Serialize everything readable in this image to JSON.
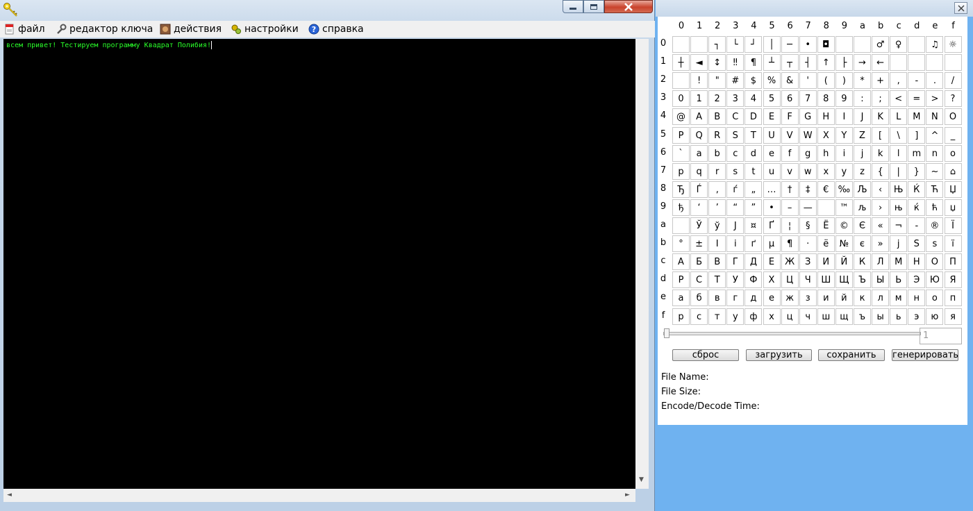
{
  "main_window": {
    "menu": [
      {
        "label": "файл",
        "icon": "file-icon"
      },
      {
        "label": "редактор ключа",
        "icon": "wrench-icon"
      },
      {
        "label": "действия",
        "icon": "actions-icon"
      },
      {
        "label": "настройки",
        "icon": "settings-icon"
      },
      {
        "label": "справка",
        "icon": "help-icon"
      }
    ],
    "editor_text": "всем привет! Тестируем программу Квадрат Полибия!"
  },
  "code_window": {
    "col_headers": [
      "0",
      "1",
      "2",
      "3",
      "4",
      "5",
      "6",
      "7",
      "8",
      "9",
      "a",
      "b",
      "c",
      "d",
      "e",
      "f"
    ],
    "row_headers": [
      "0",
      "1",
      "2",
      "3",
      "4",
      "5",
      "6",
      "7",
      "8",
      "9",
      "a",
      "b",
      "c",
      "d",
      "e",
      "f"
    ],
    "rows": [
      [
        "",
        "",
        "┐",
        "└",
        "┘",
        "│",
        "─",
        "•",
        "◘",
        "",
        "",
        "♂",
        "♀",
        "",
        "♫",
        "☼"
      ],
      [
        "┼",
        "◄",
        "↕",
        "‼",
        "¶",
        "┴",
        "┬",
        "┤",
        "↑",
        "├",
        "→",
        "←",
        "",
        "",
        "",
        ""
      ],
      [
        "",
        "!",
        "\"",
        "#",
        "$",
        "%",
        "&",
        "'",
        "(",
        ")",
        "*",
        "+",
        ",",
        "-",
        ".",
        "/"
      ],
      [
        "0",
        "1",
        "2",
        "3",
        "4",
        "5",
        "6",
        "7",
        "8",
        "9",
        ":",
        ";",
        "<",
        "=",
        ">",
        "?"
      ],
      [
        "@",
        "A",
        "B",
        "C",
        "D",
        "E",
        "F",
        "G",
        "H",
        "I",
        "J",
        "K",
        "L",
        "M",
        "N",
        "O"
      ],
      [
        "P",
        "Q",
        "R",
        "S",
        "T",
        "U",
        "V",
        "W",
        "X",
        "Y",
        "Z",
        "[",
        "\\",
        "]",
        "^",
        "_"
      ],
      [
        "`",
        "a",
        "b",
        "c",
        "d",
        "e",
        "f",
        "g",
        "h",
        "i",
        "j",
        "k",
        "l",
        "m",
        "n",
        "o"
      ],
      [
        "p",
        "q",
        "r",
        "s",
        "t",
        "u",
        "v",
        "w",
        "x",
        "y",
        "z",
        "{",
        "|",
        "}",
        "~",
        "⌂"
      ],
      [
        "Ђ",
        "Ѓ",
        "‚",
        "ѓ",
        "„",
        "…",
        "†",
        "‡",
        "€",
        "‰",
        "Љ",
        "‹",
        "Њ",
        "Ќ",
        "Ћ",
        "Џ"
      ],
      [
        "ђ",
        "‘",
        "’",
        "“",
        "”",
        "•",
        "–",
        "—",
        "",
        "™",
        "љ",
        "›",
        "њ",
        "ќ",
        "ћ",
        "џ"
      ],
      [
        "",
        "Ў",
        "ў",
        "Ј",
        "¤",
        "Ґ",
        "¦",
        "§",
        "Ё",
        "©",
        "Є",
        "«",
        "¬",
        "-",
        "®",
        "Ї"
      ],
      [
        "°",
        "±",
        "І",
        "і",
        "ґ",
        "µ",
        "¶",
        "·",
        "ё",
        "№",
        "є",
        "»",
        "ј",
        "Ѕ",
        "ѕ",
        "ї"
      ],
      [
        "А",
        "Б",
        "В",
        "Г",
        "Д",
        "Е",
        "Ж",
        "З",
        "И",
        "Й",
        "К",
        "Л",
        "М",
        "Н",
        "О",
        "П"
      ],
      [
        "Р",
        "С",
        "Т",
        "У",
        "Ф",
        "Х",
        "Ц",
        "Ч",
        "Ш",
        "Щ",
        "Ъ",
        "Ы",
        "Ь",
        "Э",
        "Ю",
        "Я"
      ],
      [
        "а",
        "б",
        "в",
        "г",
        "д",
        "е",
        "ж",
        "з",
        "и",
        "й",
        "к",
        "л",
        "м",
        "н",
        "о",
        "п"
      ],
      [
        "р",
        "с",
        "т",
        "у",
        "ф",
        "х",
        "ц",
        "ч",
        "ш",
        "щ",
        "ъ",
        "ы",
        "ь",
        "э",
        "ю",
        "я"
      ]
    ],
    "counter_value": "1",
    "buttons": {
      "reset": "сброс",
      "load": "загрузить",
      "save": "сохранить",
      "generate": "генерировать"
    },
    "info": {
      "file_name": "File Name:",
      "file_size": "File Size:",
      "time": "Encode/Decode Time:"
    }
  }
}
